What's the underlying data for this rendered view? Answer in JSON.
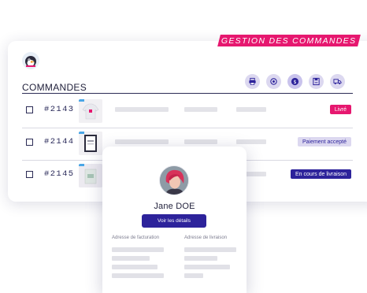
{
  "header": {
    "banner": "GESTION DES COMMANDES",
    "title": "COMMANDES"
  },
  "toolbar": {
    "icons": [
      "printer-icon",
      "refresh-icon",
      "payment-icon",
      "save-icon",
      "delivery-truck-icon"
    ]
  },
  "orders": [
    {
      "id": "#2143",
      "status": "Livré",
      "status_color": "#e6176f",
      "status_text_color": "#ffffff"
    },
    {
      "id": "#2144",
      "status": "Paiement accepté",
      "status_color": "#dcd8f0",
      "status_text_color": "#2d239b"
    },
    {
      "id": "#2145",
      "status": "En cours de livraison",
      "status_color": "#2d239b",
      "status_text_color": "#ffffff"
    }
  ],
  "customer": {
    "name": "Jane DOE",
    "button_label": "Voir les détails",
    "billing_label": "Adresse de facturation",
    "delivery_label": "Adresse de livraison"
  },
  "colors": {
    "accent_pink": "#e6176f",
    "accent_navy": "#2d239b",
    "lavender": "#dcd8f0"
  }
}
